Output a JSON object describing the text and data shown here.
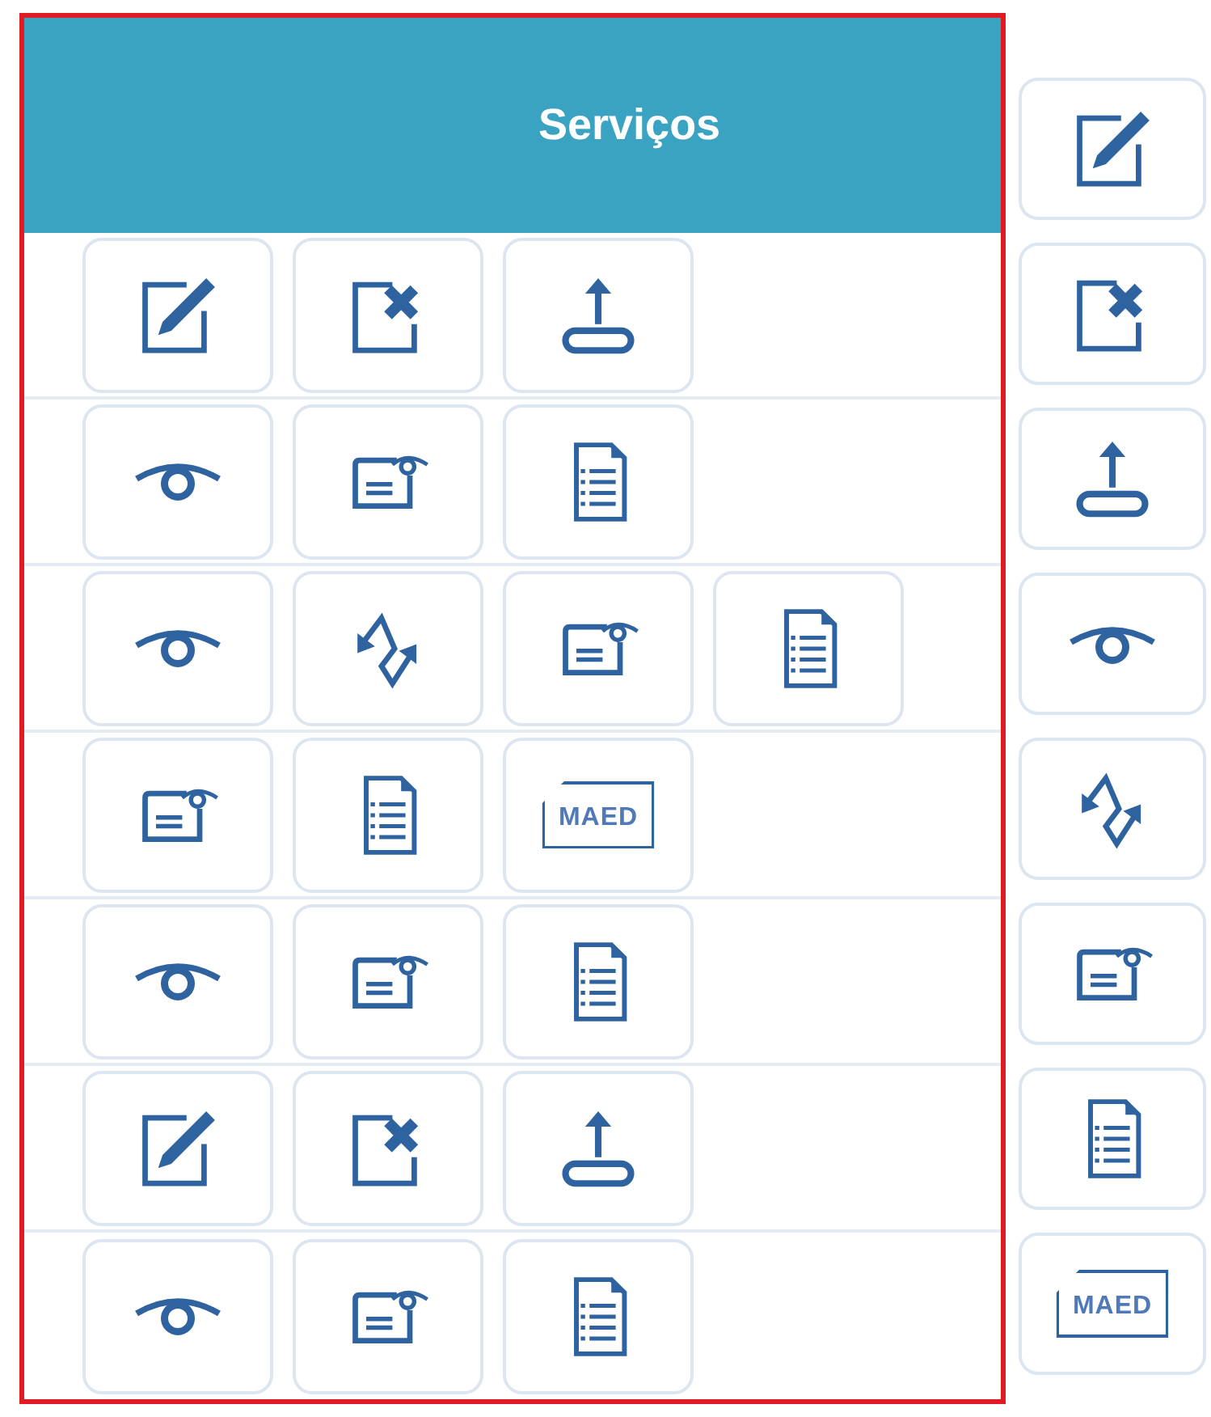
{
  "panel": {
    "title": "Serviços",
    "rows": [
      {
        "buttons": [
          {
            "kind": "edit"
          },
          {
            "kind": "delete"
          },
          {
            "kind": "upload"
          }
        ]
      },
      {
        "buttons": [
          {
            "kind": "view"
          },
          {
            "kind": "message"
          },
          {
            "kind": "document"
          }
        ]
      },
      {
        "buttons": [
          {
            "kind": "view"
          },
          {
            "kind": "workflow"
          },
          {
            "kind": "message"
          },
          {
            "kind": "document"
          }
        ]
      },
      {
        "buttons": [
          {
            "kind": "message"
          },
          {
            "kind": "document"
          },
          {
            "kind": "maed",
            "label": "MAED"
          }
        ]
      },
      {
        "buttons": [
          {
            "kind": "view"
          },
          {
            "kind": "message"
          },
          {
            "kind": "document"
          }
        ]
      },
      {
        "buttons": [
          {
            "kind": "edit"
          },
          {
            "kind": "delete"
          },
          {
            "kind": "upload"
          }
        ]
      },
      {
        "buttons": [
          {
            "kind": "view"
          },
          {
            "kind": "message"
          },
          {
            "kind": "document"
          }
        ]
      }
    ]
  },
  "legend": [
    {
      "kind": "edit"
    },
    {
      "kind": "delete"
    },
    {
      "kind": "upload"
    },
    {
      "kind": "view"
    },
    {
      "kind": "workflow"
    },
    {
      "kind": "message"
    },
    {
      "kind": "document"
    },
    {
      "kind": "maed",
      "label": "MAED"
    }
  ]
}
